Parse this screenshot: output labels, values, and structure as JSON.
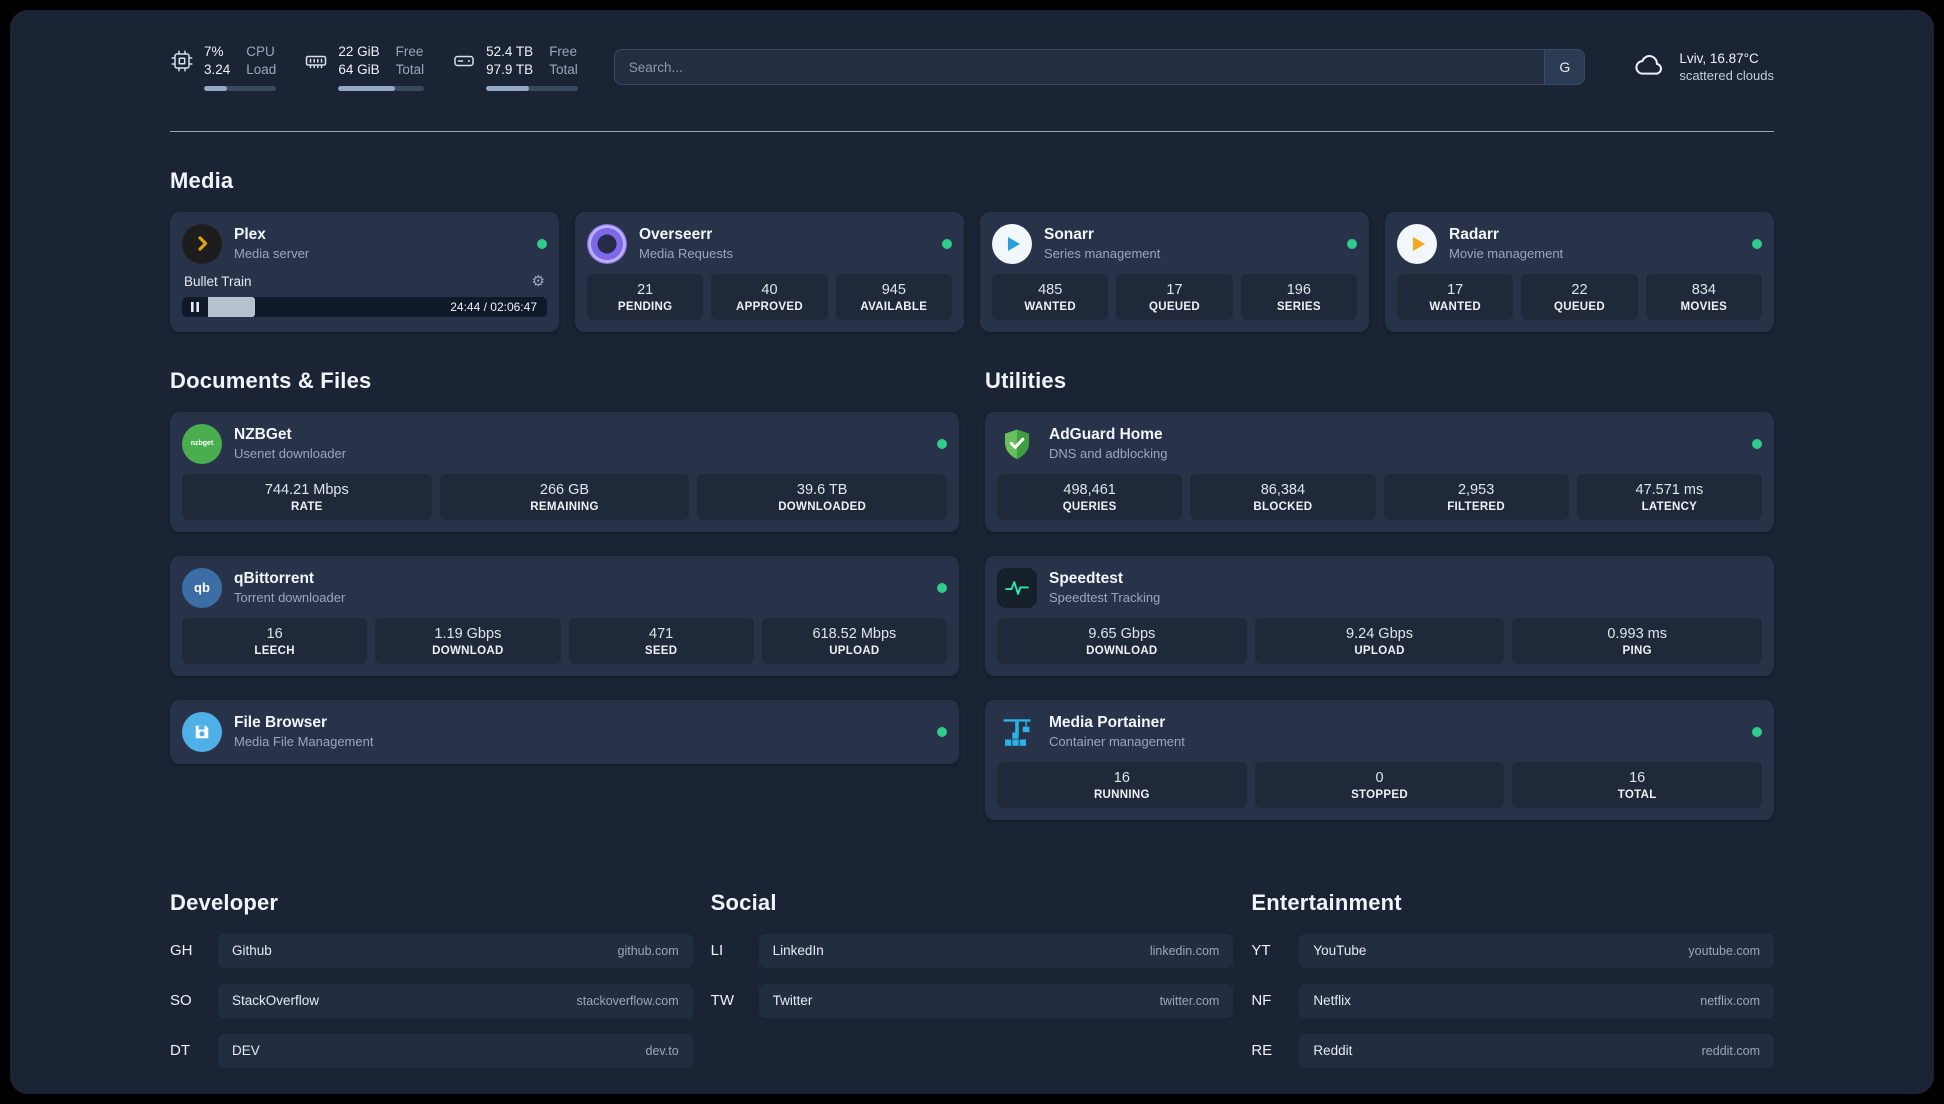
{
  "topbar": {
    "cpu": {
      "usage": "7%",
      "load": "3.24",
      "label_usage": "CPU",
      "label_load": "Load",
      "progress_pct": 32
    },
    "memory": {
      "free": "22 GiB",
      "total": "64 GiB",
      "label_free": "Free",
      "label_total": "Total",
      "progress_pct": 66
    },
    "disk": {
      "free": "52.4 TB",
      "total": "97.9 TB",
      "label_free": "Free",
      "label_total": "Total",
      "progress_pct": 47
    },
    "search": {
      "placeholder": "Search...",
      "provider": "G"
    },
    "weather": {
      "location": "Lviv, 16.87°C",
      "condition": "scattered clouds"
    }
  },
  "sections": {
    "media": {
      "title": "Media"
    },
    "documents": {
      "title": "Documents & Files"
    },
    "utilities": {
      "title": "Utilities"
    }
  },
  "services": {
    "plex": {
      "name": "Plex",
      "desc": "Media server",
      "now_playing": "Bullet Train",
      "time": "24:44 / 02:06:47",
      "progress_pct": 13
    },
    "overseerr": {
      "name": "Overseerr",
      "desc": "Media Requests",
      "stats": [
        {
          "value": "21",
          "label": "PENDING"
        },
        {
          "value": "40",
          "label": "APPROVED"
        },
        {
          "value": "945",
          "label": "AVAILABLE"
        }
      ]
    },
    "sonarr": {
      "name": "Sonarr",
      "desc": "Series management",
      "stats": [
        {
          "value": "485",
          "label": "WANTED"
        },
        {
          "value": "17",
          "label": "QUEUED"
        },
        {
          "value": "196",
          "label": "SERIES"
        }
      ]
    },
    "radarr": {
      "name": "Radarr",
      "desc": "Movie management",
      "stats": [
        {
          "value": "17",
          "label": "WANTED"
        },
        {
          "value": "22",
          "label": "QUEUED"
        },
        {
          "value": "834",
          "label": "MOVIES"
        }
      ]
    },
    "nzbget": {
      "name": "NZBGet",
      "desc": "Usenet downloader",
      "icon_text": "nzbget",
      "stats": [
        {
          "value": "744.21 Mbps",
          "label": "RATE"
        },
        {
          "value": "266 GB",
          "label": "REMAINING"
        },
        {
          "value": "39.6 TB",
          "label": "DOWNLOADED"
        }
      ]
    },
    "qbittorrent": {
      "name": "qBittorrent",
      "desc": "Torrent downloader",
      "icon_text": "qb",
      "stats": [
        {
          "value": "16",
          "label": "LEECH"
        },
        {
          "value": "1.19 Gbps",
          "label": "DOWNLOAD"
        },
        {
          "value": "471",
          "label": "SEED"
        },
        {
          "value": "618.52 Mbps",
          "label": "UPLOAD"
        }
      ]
    },
    "filebrowser": {
      "name": "File Browser",
      "desc": "Media File Management"
    },
    "adguard": {
      "name": "AdGuard Home",
      "desc": "DNS and adblocking",
      "stats": [
        {
          "value": "498,461",
          "label": "QUERIES"
        },
        {
          "value": "86,384",
          "label": "BLOCKED"
        },
        {
          "value": "2,953",
          "label": "FILTERED"
        },
        {
          "value": "47.571 ms",
          "label": "LATENCY"
        }
      ]
    },
    "speedtest": {
      "name": "Speedtest",
      "desc": "Speedtest Tracking",
      "stats": [
        {
          "value": "9.65 Gbps",
          "label": "DOWNLOAD"
        },
        {
          "value": "9.24 Gbps",
          "label": "UPLOAD"
        },
        {
          "value": "0.993 ms",
          "label": "PING"
        }
      ]
    },
    "portainer": {
      "name": "Media Portainer",
      "desc": "Container management",
      "stats": [
        {
          "value": "16",
          "label": "RUNNING"
        },
        {
          "value": "0",
          "label": "STOPPED"
        },
        {
          "value": "16",
          "label": "TOTAL"
        }
      ]
    }
  },
  "bookmarks": {
    "developer": {
      "title": "Developer",
      "items": [
        {
          "abbr": "GH",
          "name": "Github",
          "domain": "github.com"
        },
        {
          "abbr": "SO",
          "name": "StackOverflow",
          "domain": "stackoverflow.com"
        },
        {
          "abbr": "DT",
          "name": "DEV",
          "domain": "dev.to"
        }
      ]
    },
    "social": {
      "title": "Social",
      "items": [
        {
          "abbr": "LI",
          "name": "LinkedIn",
          "domain": "linkedin.com"
        },
        {
          "abbr": "TW",
          "name": "Twitter",
          "domain": "twitter.com"
        }
      ]
    },
    "entertainment": {
      "title": "Entertainment",
      "items": [
        {
          "abbr": "YT",
          "name": "YouTube",
          "domain": "youtube.com"
        },
        {
          "abbr": "NF",
          "name": "Netflix",
          "domain": "netflix.com"
        },
        {
          "abbr": "RE",
          "name": "Reddit",
          "domain": "reddit.com"
        }
      ]
    }
  },
  "colors": {
    "page_bg": "#1b2434",
    "card_bg": "#283349",
    "status_green": "#2fcb8b",
    "plex_amber": "#e5a00d",
    "sonarr_blue": "#2a9fd8",
    "radarr_amber": "#f5a623",
    "nzbget_green": "#4aae4e",
    "qbittorrent_blue": "#3c6ea5",
    "filebrowser_blue": "#4fb0e8",
    "adguard_green": "#5cb85c",
    "speedtest_green": "#2ee6a8",
    "portainer_blue": "#29b3e6"
  }
}
